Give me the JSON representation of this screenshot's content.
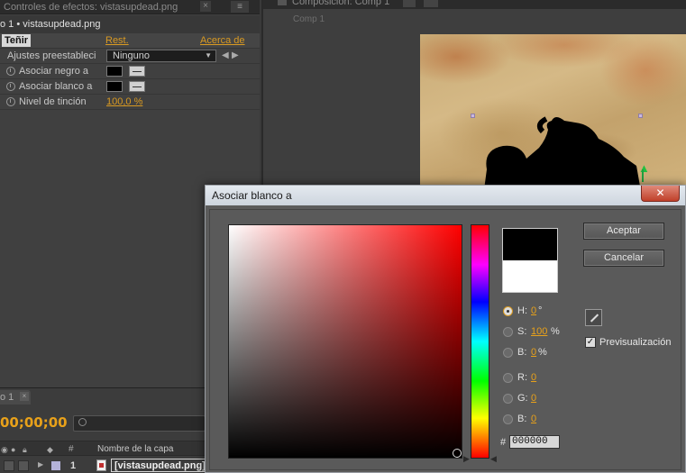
{
  "effects_panel": {
    "tab_title": "Controles de efectos: vistasupdead.png",
    "tab_close": "×",
    "panel_menu_icon": "≡",
    "subheader": "o 1 • vistasupdead.png",
    "effect_name": "Teñir",
    "reset_label": "Rest.",
    "about_label": "Acerca de",
    "presets_label": "Ajustes preestableci",
    "presets_value": "Ninguno",
    "map_black_label": "Asociar negro a",
    "map_white_label": "Asociar blanco a",
    "tint_label": "Nivel de tinción",
    "tint_value": "100,0 %"
  },
  "timeline": {
    "tab_label": "o 1",
    "tab_close": "×",
    "timecode": "00;00;00",
    "columns": {
      "number": "#",
      "layer_name": "Nombre de la capa"
    },
    "layer": {
      "number": "1",
      "name": "[vistasupdead.png]",
      "label_color": "#b4b2d8"
    }
  },
  "composition": {
    "tab_title": "Composición: Comp 1",
    "subtab": "Comp 1"
  },
  "dialog": {
    "title": "Asociar blanco a",
    "close": "✕",
    "accept": "Aceptar",
    "cancel": "Cancelar",
    "preview_label": "Previsualización",
    "preview_checked": true,
    "new_color": "#000000",
    "old_color": "#ffffff",
    "fields": {
      "h": {
        "label": "H:",
        "value": "0",
        "unit": "°"
      },
      "s": {
        "label": "S:",
        "value": "100",
        "unit": "%"
      },
      "b": {
        "label": "B:",
        "value": "0",
        "unit": "%"
      },
      "r": {
        "label": "R:",
        "value": "0"
      },
      "g": {
        "label": "G:",
        "value": "0"
      },
      "bb": {
        "label": "B:",
        "value": "0"
      }
    },
    "hex_label": "#",
    "hex_value": "000000"
  },
  "colors": {
    "accent": "#d99a22",
    "timecode": "#e8a11a"
  }
}
